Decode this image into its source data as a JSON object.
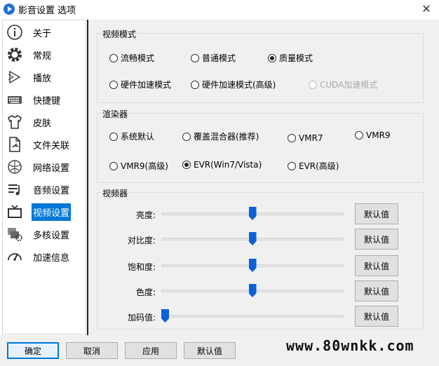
{
  "window": {
    "title": "影音设置 选项",
    "close_glyph": "✕"
  },
  "sidebar": {
    "items": [
      {
        "label": "关于",
        "icon": "info-icon"
      },
      {
        "label": "常规",
        "icon": "gear-icon"
      },
      {
        "label": "播放",
        "icon": "play-icon"
      },
      {
        "label": "快捷键",
        "icon": "keyboard-icon"
      },
      {
        "label": "皮肤",
        "icon": "shirt-icon"
      },
      {
        "label": "文件关联",
        "icon": "file-link-icon"
      },
      {
        "label": "网络设置",
        "icon": "network-icon"
      },
      {
        "label": "音频设置",
        "icon": "audio-icon"
      },
      {
        "label": "视频设置",
        "icon": "tv-icon"
      },
      {
        "label": "多核设置",
        "icon": "multicore-icon"
      },
      {
        "label": "加速信息",
        "icon": "speedometer-icon"
      }
    ],
    "active_index": 8
  },
  "video_mode": {
    "title": "视频模式",
    "options": [
      {
        "label": "流畅模式",
        "checked": false,
        "disabled": false
      },
      {
        "label": "普通模式",
        "checked": false,
        "disabled": false
      },
      {
        "label": "质量模式",
        "checked": true,
        "disabled": false
      },
      {
        "label": "硬件加速模式",
        "checked": false,
        "disabled": false
      },
      {
        "label": "硬件加速模式(高级)",
        "checked": false,
        "disabled": false
      },
      {
        "label": "CUDA加速模式",
        "checked": false,
        "disabled": true
      }
    ]
  },
  "renderer": {
    "title": "渲染器",
    "options": [
      {
        "label": "系统默认",
        "checked": false
      },
      {
        "label": "覆盖混合器(推荐)",
        "checked": false
      },
      {
        "label": "VMR7",
        "checked": false
      },
      {
        "label": "VMR9",
        "checked": false
      },
      {
        "label": "VMR9(高级)",
        "checked": false
      },
      {
        "label": "EVR(Win7/Vista)",
        "checked": true
      },
      {
        "label": "EVR(高级)",
        "checked": false
      }
    ]
  },
  "video_adjust": {
    "title": "视频器",
    "default_label": "默认值",
    "sliders": [
      {
        "label": "亮度:",
        "value": 0.5
      },
      {
        "label": "对比度:",
        "value": 0.5
      },
      {
        "label": "饱和度:",
        "value": 0.5
      },
      {
        "label": "色度:",
        "value": 0.5
      },
      {
        "label": "加码值:",
        "value": 0.0
      }
    ]
  },
  "bottom": {
    "ok": "确定",
    "cancel": "取消",
    "apply": "应用",
    "default": "默认值",
    "watermark": "www.80wnkk.com"
  },
  "colors": {
    "accent": "#0078d7",
    "slider_thumb": "#0b61d6"
  }
}
